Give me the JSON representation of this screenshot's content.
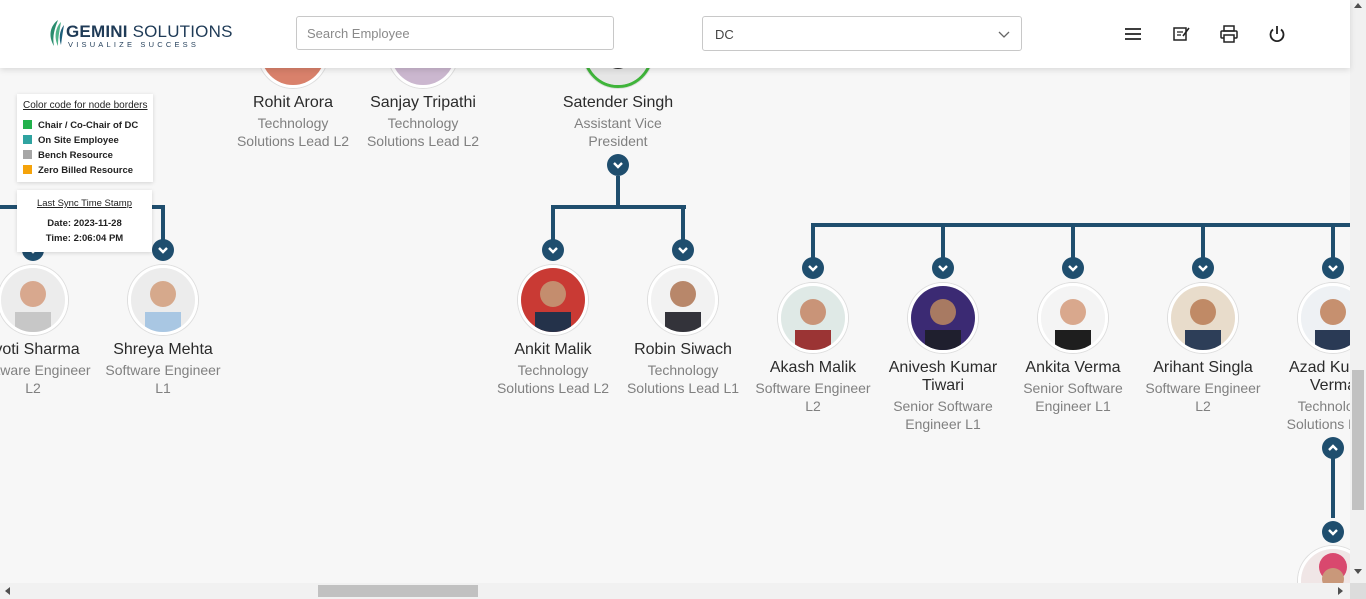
{
  "header": {
    "logo_brand": "GEMINI",
    "logo_brand2": " SOLUTIONS",
    "logo_tagline": "VISUALIZE SUCCESS",
    "search_placeholder": "Search Employee",
    "dc_value": "DC",
    "icons": [
      "menu-icon",
      "notes-icon",
      "print-icon",
      "power-icon"
    ]
  },
  "legend": {
    "title": "Color code for node borders",
    "items": [
      {
        "label": "Chair / Co-Chair of DC",
        "color": "#22b14c"
      },
      {
        "label": "On Site Employee",
        "color": "#2fa3a0"
      },
      {
        "label": "Bench Resource",
        "color": "#a6a6a6"
      },
      {
        "label": "Zero Billed Resource",
        "color": "#f5a30a"
      }
    ]
  },
  "sync": {
    "title": "Last Sync Time Stamp",
    "date": "Date: 2023-11-28",
    "time": "Time: 2:06:04 PM"
  },
  "nodes": {
    "rohit": {
      "name": "Rohit Arora",
      "title1": "Technology",
      "title2": "Solutions Lead L2"
    },
    "sanjay": {
      "name": "Sanjay Tripathi",
      "title1": "Technology",
      "title2": "Solutions Lead L2"
    },
    "satender": {
      "name": "Satender Singh",
      "title1": "Assistant Vice",
      "title2": "President"
    },
    "jyoti": {
      "name": "Jyoti Sharma",
      "title1": "Software Engineer",
      "title2": "L2"
    },
    "shreya": {
      "name": "Shreya Mehta",
      "title1": "Software Engineer",
      "title2": "L1"
    },
    "ankit": {
      "name": "Ankit Malik",
      "title1": "Technology",
      "title2": "Solutions Lead L2"
    },
    "robin": {
      "name": "Robin Siwach",
      "title1": "Technology",
      "title2": "Solutions Lead L1"
    },
    "akash": {
      "name": "Akash Malik",
      "title1": "Software Engineer",
      "title2": "L2"
    },
    "anivesh": {
      "name1": "Anivesh Kumar",
      "name2": "Tiwari",
      "title1": "Senior Software",
      "title2": "Engineer L1"
    },
    "ankita": {
      "name": "Ankita Verma",
      "title1": "Senior Software",
      "title2": "Engineer L1"
    },
    "arihant": {
      "name": "Arihant Singla",
      "title1": "Software Engineer",
      "title2": "L2"
    },
    "azad": {
      "name1": "Azad Kumar",
      "name2": "Verma",
      "title1": "Technology",
      "title2": "Solutions Lead"
    }
  }
}
